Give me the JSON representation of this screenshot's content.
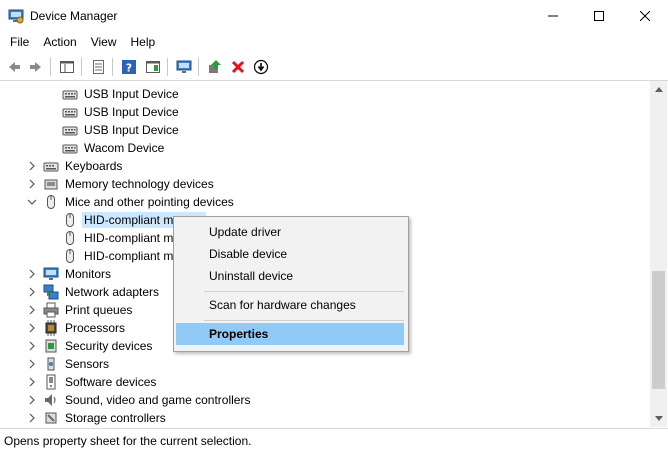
{
  "window": {
    "title": "Device Manager",
    "controls": {
      "minimize": "—",
      "maximize": "☐",
      "close": "✕"
    }
  },
  "menubar": [
    "File",
    "Action",
    "View",
    "Help"
  ],
  "toolbar": {
    "buttons": [
      "back-icon",
      "forward-icon",
      "show-hide-console-tree-icon",
      "properties-icon",
      "help-icon",
      "action-pane-icon",
      "monitor-icon",
      "update-driver-icon",
      "uninstall-icon",
      "scan-hardware-icon"
    ]
  },
  "tree": [
    {
      "label": "USB Input Device",
      "level": 2,
      "icon": "hid-keyboard-icon"
    },
    {
      "label": "USB Input Device",
      "level": 2,
      "icon": "hid-keyboard-icon"
    },
    {
      "label": "USB Input Device",
      "level": 2,
      "icon": "hid-keyboard-icon"
    },
    {
      "label": "Wacom Device",
      "level": 2,
      "icon": "hid-keyboard-icon"
    },
    {
      "label": "Keyboards",
      "level": 1,
      "icon": "keyboard-icon",
      "expander": "›"
    },
    {
      "label": "Memory technology devices",
      "level": 1,
      "icon": "memory-card-icon",
      "expander": "›"
    },
    {
      "label": "Mice and other pointing devices",
      "level": 1,
      "icon": "mouse-icon",
      "expander": "⌄"
    },
    {
      "label": "HID-compliant m",
      "level": 2,
      "icon": "mouse-icon",
      "selected": true
    },
    {
      "label": "HID-compliant m",
      "level": 2,
      "icon": "mouse-icon"
    },
    {
      "label": "HID-compliant m",
      "level": 2,
      "icon": "mouse-icon"
    },
    {
      "label": "Monitors",
      "level": 1,
      "icon": "monitor-icon",
      "expander": "›"
    },
    {
      "label": "Network adapters",
      "level": 1,
      "icon": "network-adapter-icon",
      "expander": "›"
    },
    {
      "label": "Print queues",
      "level": 1,
      "icon": "printer-icon",
      "expander": "›"
    },
    {
      "label": "Processors",
      "level": 1,
      "icon": "processor-icon",
      "expander": "›"
    },
    {
      "label": "Security devices",
      "level": 1,
      "icon": "security-device-icon",
      "expander": "›"
    },
    {
      "label": "Sensors",
      "level": 1,
      "icon": "sensor-icon",
      "expander": "›"
    },
    {
      "label": "Software devices",
      "level": 1,
      "icon": "software-device-icon",
      "expander": "›"
    },
    {
      "label": "Sound, video and game controllers",
      "level": 1,
      "icon": "speaker-icon",
      "expander": "›"
    },
    {
      "label": "Storage controllers",
      "level": 1,
      "icon": "storage-controller-icon",
      "expander": "›"
    }
  ],
  "context_menu": {
    "items": [
      {
        "label": "Update driver"
      },
      {
        "label": "Disable device"
      },
      {
        "label": "Uninstall device"
      },
      {
        "label": "Scan for hardware changes"
      },
      {
        "label": "Properties",
        "highlighted": true
      }
    ]
  },
  "status": {
    "text": "Opens property sheet for the current selection."
  },
  "colors": {
    "selection": "#cce8ff",
    "menu_highlight": "#91c9f7",
    "menu_bg": "#f2f2f2",
    "uninstall_red": "#e81123"
  }
}
